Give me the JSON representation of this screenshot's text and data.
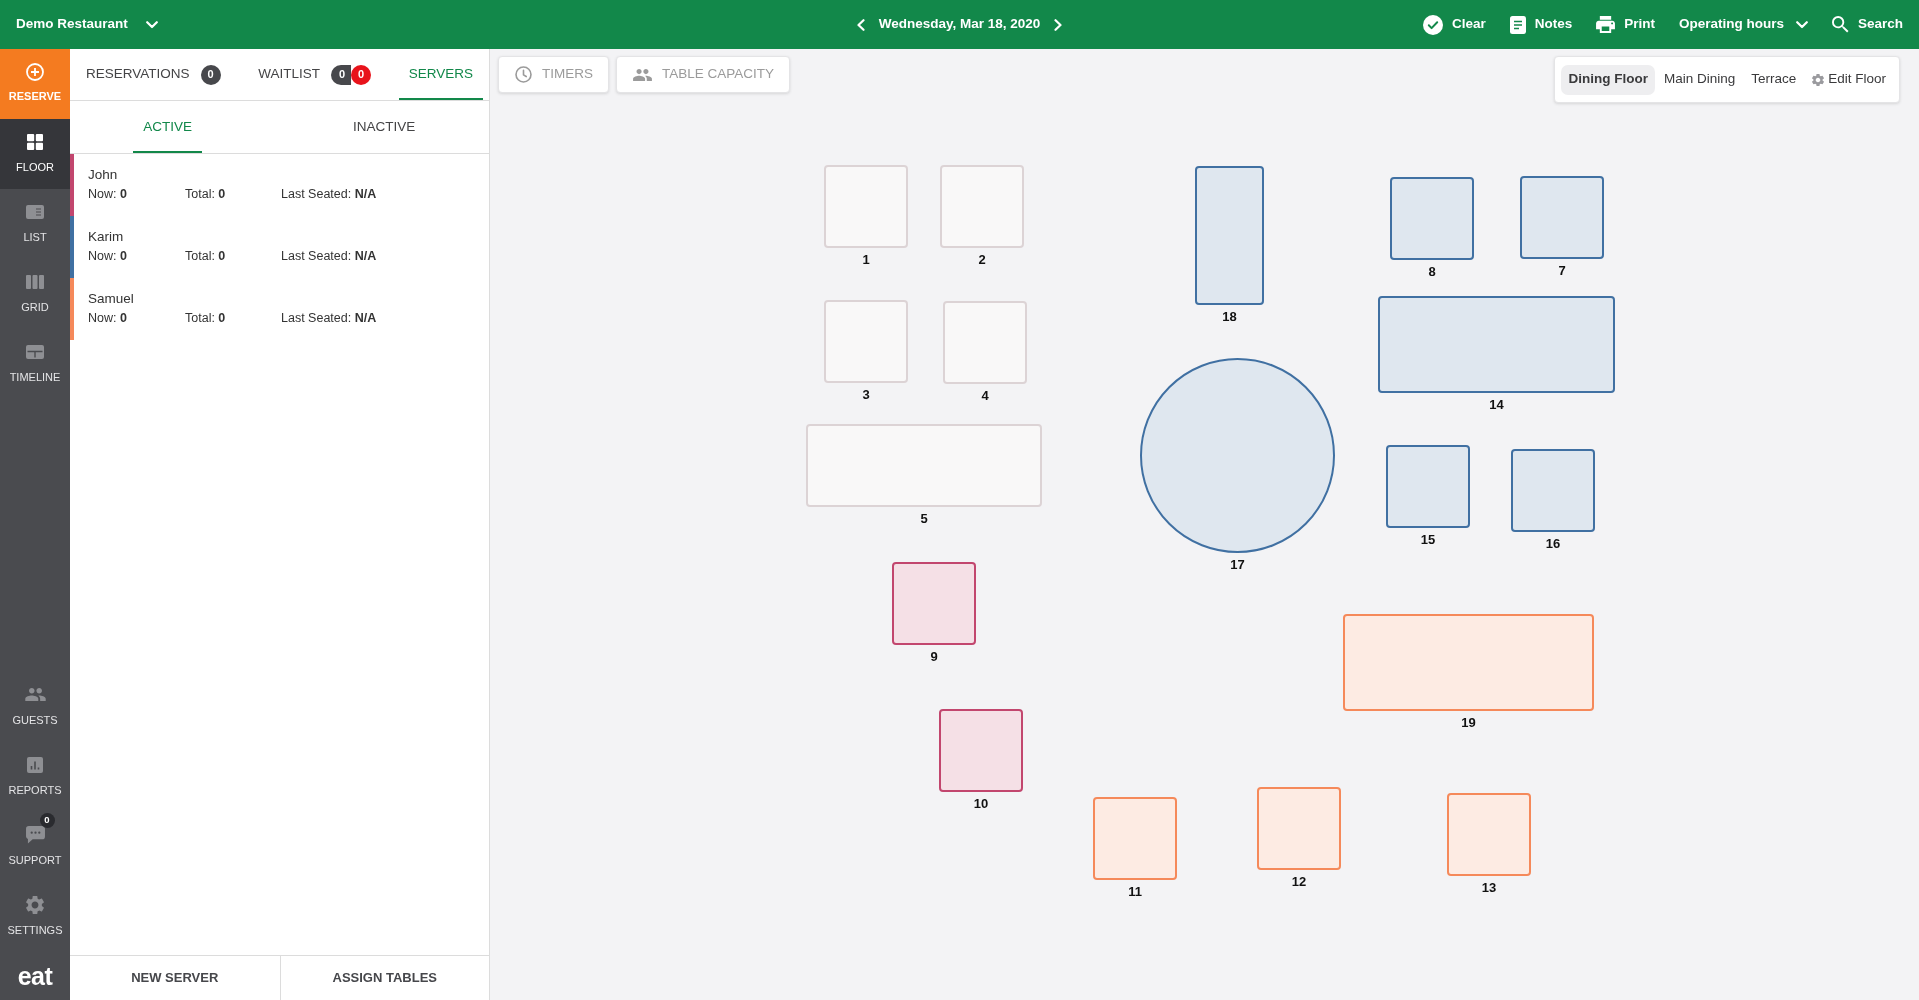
{
  "top_bar": {
    "restaurant": "Demo Restaurant",
    "date": "Wednesday, Mar 18, 2020",
    "actions": [
      {
        "kind": "clear",
        "label": "Clear"
      },
      {
        "kind": "notes",
        "label": "Notes"
      },
      {
        "kind": "print",
        "label": "Print"
      },
      {
        "kind": "hours",
        "label": "Operating hours"
      },
      {
        "kind": "search",
        "label": "Search"
      }
    ]
  },
  "sidebar": {
    "reserve": "RESERVE",
    "items": [
      {
        "kind": "floor",
        "label": "FLOOR",
        "selected": true
      },
      {
        "kind": "list",
        "label": "LIST",
        "selected": false
      },
      {
        "kind": "grid",
        "label": "GRID",
        "selected": false
      },
      {
        "kind": "timeline",
        "label": "TIMELINE",
        "selected": false
      }
    ],
    "bottom_items": [
      {
        "kind": "guests",
        "label": "GUESTS",
        "selected": false
      },
      {
        "kind": "reports",
        "label": "REPORTS",
        "selected": false
      },
      {
        "kind": "support",
        "label": "SUPPORT",
        "selected": false,
        "badge": "0"
      },
      {
        "kind": "settings",
        "label": "SETTINGS",
        "selected": false
      }
    ],
    "logo": "eat"
  },
  "panel": {
    "tabs": [
      {
        "label": "RESERVATIONS",
        "selected": false,
        "badges": [
          {
            "text": "0",
            "color": "#47484c"
          }
        ]
      },
      {
        "label": "WAITLIST",
        "selected": false,
        "badges": [
          {
            "text": "0",
            "color": "#47484c"
          },
          {
            "text": "0",
            "color": "#e8131b"
          }
        ]
      },
      {
        "label": "SERVERS",
        "selected": true
      }
    ],
    "subtabs": [
      {
        "label": "ACTIVE",
        "selected": true
      },
      {
        "label": "INACTIVE",
        "selected": false
      }
    ],
    "servers": [
      {
        "name": "John",
        "color": "#c2466e",
        "now": "Now: **0**",
        "total": "Total: **0**",
        "last_seated": "Last Seated: **N/A**"
      },
      {
        "name": "Karim",
        "color": "#4070a2",
        "now": "Now: **0**",
        "total": "Total: **0**",
        "last_seated": "Last Seated: **N/A**"
      },
      {
        "name": "Samuel",
        "color": "#f5895a",
        "now": "Now: **0**",
        "total": "Total: **0**",
        "last_seated": "Last Seated: **N/A**"
      }
    ],
    "buttons": [
      "NEW SERVER",
      "ASSIGN TABLES"
    ]
  },
  "toolbar": [
    {
      "kind": "timers",
      "label": "TIMERS"
    },
    {
      "kind": "capacity",
      "label": "TABLE CAPACITY"
    }
  ],
  "floors": {
    "tabs": [
      {
        "label": "Dining Floor",
        "selected": true
      },
      {
        "label": "Main Dining",
        "selected": false
      },
      {
        "label": "Terrace",
        "selected": false
      }
    ],
    "edit": "Edit Floor"
  },
  "tables": [
    {
      "number": "1",
      "kind": "rect",
      "color": "#dcd3d5"
    },
    {
      "number": "2",
      "kind": "rect",
      "color": "#dcd3d5"
    },
    {
      "number": "3",
      "kind": "rect",
      "color": "#dcd3d5"
    },
    {
      "number": "4",
      "kind": "rect",
      "color": "#dcd3d5"
    },
    {
      "number": "5",
      "kind": "rect",
      "color": "#dcd3d5"
    },
    {
      "number": "7",
      "kind": "rect",
      "color": "#4070a2"
    },
    {
      "number": "8",
      "kind": "rect",
      "color": "#4070a2"
    },
    {
      "number": "9",
      "kind": "rect",
      "color": "#c2466e"
    },
    {
      "number": "10",
      "kind": "rect",
      "color": "#c2466e"
    },
    {
      "number": "11",
      "kind": "rect",
      "color": "#f5895a"
    },
    {
      "number": "12",
      "kind": "rect",
      "color": "#f5895a"
    },
    {
      "number": "13",
      "kind": "rect",
      "color": "#f5895a"
    },
    {
      "number": "14",
      "kind": "rect",
      "color": "#4070a2"
    },
    {
      "number": "15",
      "kind": "rect",
      "color": "#4070a2"
    },
    {
      "number": "16",
      "kind": "rect",
      "color": "#4070a2"
    },
    {
      "number": "17",
      "kind": "circle",
      "color": "#4070a2"
    },
    {
      "number": "18",
      "kind": "rect",
      "color": "#4070a2"
    },
    {
      "number": "19",
      "kind": "rect",
      "color": "#f5895a"
    }
  ]
}
